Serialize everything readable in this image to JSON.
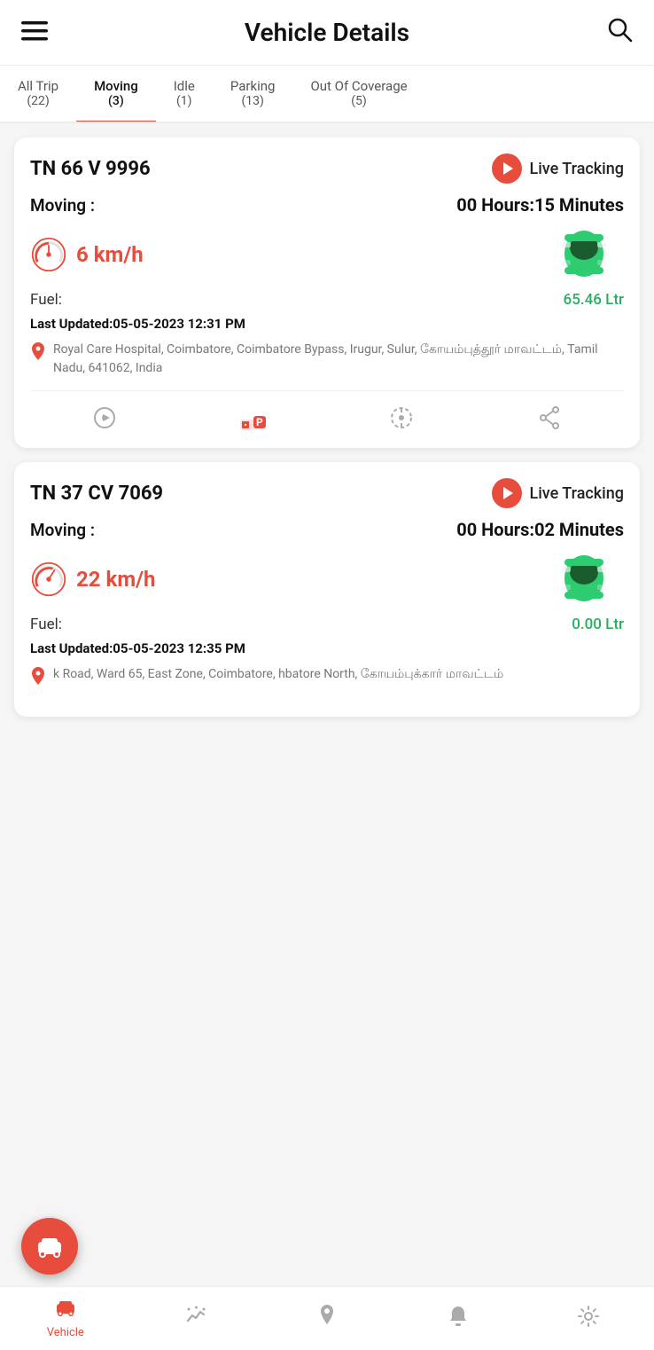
{
  "header": {
    "title": "Vehicle Details",
    "hamburger_label": "≡",
    "search_label": "🔍"
  },
  "tabs": [
    {
      "id": "all",
      "label": "All Trip",
      "count": "(22)",
      "active": false
    },
    {
      "id": "moving",
      "label": "Moving",
      "count": "(3)",
      "active": true
    },
    {
      "id": "idle",
      "label": "Idle",
      "count": "(1)",
      "active": false
    },
    {
      "id": "parking",
      "label": "Parking",
      "count": "(13)",
      "active": false
    },
    {
      "id": "out",
      "label": "Out Of Coverage",
      "count": "(5)",
      "active": false
    }
  ],
  "vehicles": [
    {
      "plate": "TN 66 V 9996",
      "live_tracking_label": "Live Tracking",
      "status_label": "Moving :",
      "status_time": "00 Hours:15 Minutes",
      "speed": "6 km/h",
      "fuel_label": "Fuel:",
      "fuel_value": "65.46 Ltr",
      "last_updated_prefix": "Last Updated:",
      "last_updated_value": "05-05-2023 12:31 PM",
      "location": "Royal Care Hospital, Coimbatore, Coimbatore Bypass, Irugur, Sulur, கோயம்புத்தூர் மாவட்டம், Tamil Nadu, 641062, India",
      "actions": [
        "replay",
        "parking",
        "geofence",
        "share"
      ]
    },
    {
      "plate": "TN 37 CV 7069",
      "live_tracking_label": "Live Tracking",
      "status_label": "Moving :",
      "status_time": "00 Hours:02 Minutes",
      "speed": "22 km/h",
      "fuel_label": "Fuel:",
      "fuel_value": "0.00 Ltr",
      "last_updated_prefix": "Last Updated:",
      "last_updated_value": "05-05-2023 12:35 PM",
      "location": "k Road, Ward 65, East Zone, Coimbatore, hbatore North, கோயம்புக்கார் மாவட்டம்",
      "actions": []
    }
  ],
  "bottom_nav": [
    {
      "id": "vehicle",
      "label": "Vehicle",
      "icon": "🚗",
      "active": true
    },
    {
      "id": "analytics",
      "label": "",
      "icon": "✨",
      "active": false
    },
    {
      "id": "location",
      "label": "",
      "icon": "📍",
      "active": false
    },
    {
      "id": "alerts",
      "label": "",
      "icon": "🔔",
      "active": false
    },
    {
      "id": "settings",
      "label": "",
      "icon": "⚙️",
      "active": false
    }
  ],
  "fab": {
    "icon": "🚗"
  },
  "colors": {
    "accent_red": "#e74c3c",
    "accent_green": "#27ae60",
    "text_dark": "#111111",
    "text_muted": "#777777"
  }
}
